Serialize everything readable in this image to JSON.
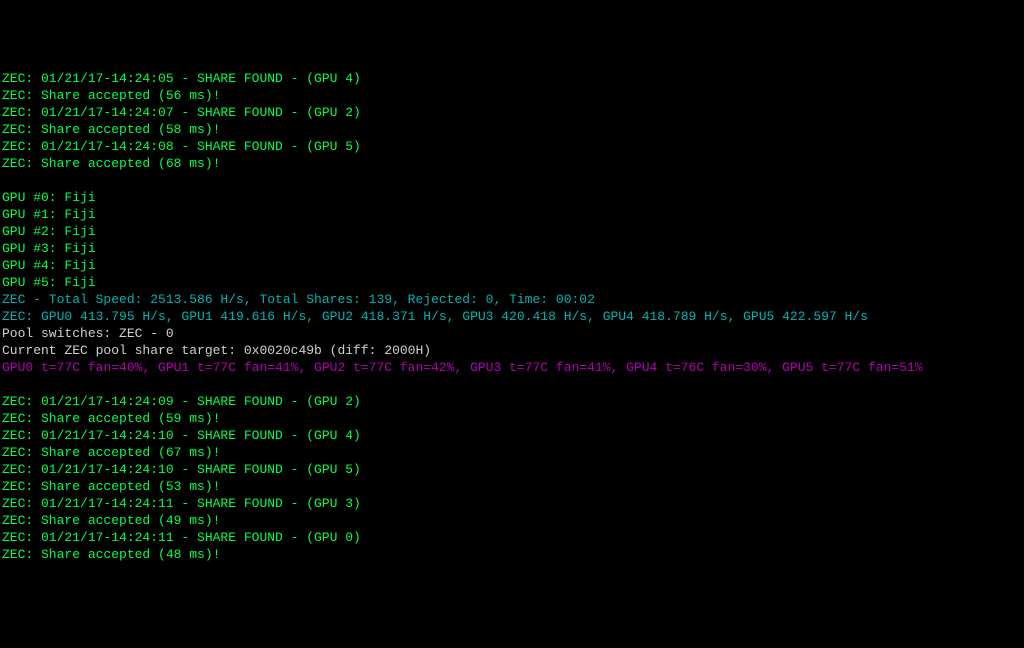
{
  "lines": [
    {
      "cls": "green",
      "text": "ZEC: 01/21/17-14:24:05 - SHARE FOUND - (GPU 4)"
    },
    {
      "cls": "green",
      "text": "ZEC: Share accepted (56 ms)!"
    },
    {
      "cls": "green",
      "text": "ZEC: 01/21/17-14:24:07 - SHARE FOUND - (GPU 2)"
    },
    {
      "cls": "green",
      "text": "ZEC: Share accepted (58 ms)!"
    },
    {
      "cls": "green",
      "text": "ZEC: 01/21/17-14:24:08 - SHARE FOUND - (GPU 5)"
    },
    {
      "cls": "green",
      "text": "ZEC: Share accepted (68 ms)!"
    },
    {
      "cls": "blank",
      "text": ""
    },
    {
      "cls": "green",
      "text": "GPU #0: Fiji"
    },
    {
      "cls": "green",
      "text": "GPU #1: Fiji"
    },
    {
      "cls": "green",
      "text": "GPU #2: Fiji"
    },
    {
      "cls": "green",
      "text": "GPU #3: Fiji"
    },
    {
      "cls": "green",
      "text": "GPU #4: Fiji"
    },
    {
      "cls": "green",
      "text": "GPU #5: Fiji"
    },
    {
      "cls": "teal",
      "text": "ZEC - Total Speed: 2513.586 H/s, Total Shares: 139, Rejected: 0, Time: 00:02"
    },
    {
      "cls": "teal",
      "text": "ZEC: GPU0 413.795 H/s, GPU1 419.616 H/s, GPU2 418.371 H/s, GPU3 420.418 H/s, GPU4 418.789 H/s, GPU5 422.597 H/s"
    },
    {
      "cls": "white",
      "text": "Pool switches: ZEC - 0"
    },
    {
      "cls": "white",
      "text": "Current ZEC pool share target: 0x0020c49b (diff: 2000H)"
    },
    {
      "cls": "magenta",
      "text": "GPU0 t=77C fan=40%, GPU1 t=77C fan=41%, GPU2 t=77C fan=42%, GPU3 t=77C fan=41%, GPU4 t=76C fan=30%, GPU5 t=77C fan=51%"
    },
    {
      "cls": "blank",
      "text": ""
    },
    {
      "cls": "green",
      "text": "ZEC: 01/21/17-14:24:09 - SHARE FOUND - (GPU 2)"
    },
    {
      "cls": "green",
      "text": "ZEC: Share accepted (59 ms)!"
    },
    {
      "cls": "green",
      "text": "ZEC: 01/21/17-14:24:10 - SHARE FOUND - (GPU 4)"
    },
    {
      "cls": "green",
      "text": "ZEC: Share accepted (67 ms)!"
    },
    {
      "cls": "green",
      "text": "ZEC: 01/21/17-14:24:10 - SHARE FOUND - (GPU 5)"
    },
    {
      "cls": "green",
      "text": "ZEC: Share accepted (53 ms)!"
    },
    {
      "cls": "green",
      "text": "ZEC: 01/21/17-14:24:11 - SHARE FOUND - (GPU 3)"
    },
    {
      "cls": "green",
      "text": "ZEC: Share accepted (49 ms)!"
    },
    {
      "cls": "green",
      "text": "ZEC: 01/21/17-14:24:11 - SHARE FOUND - (GPU 0)"
    },
    {
      "cls": "green",
      "text": "ZEC: Share accepted (48 ms)!"
    }
  ]
}
